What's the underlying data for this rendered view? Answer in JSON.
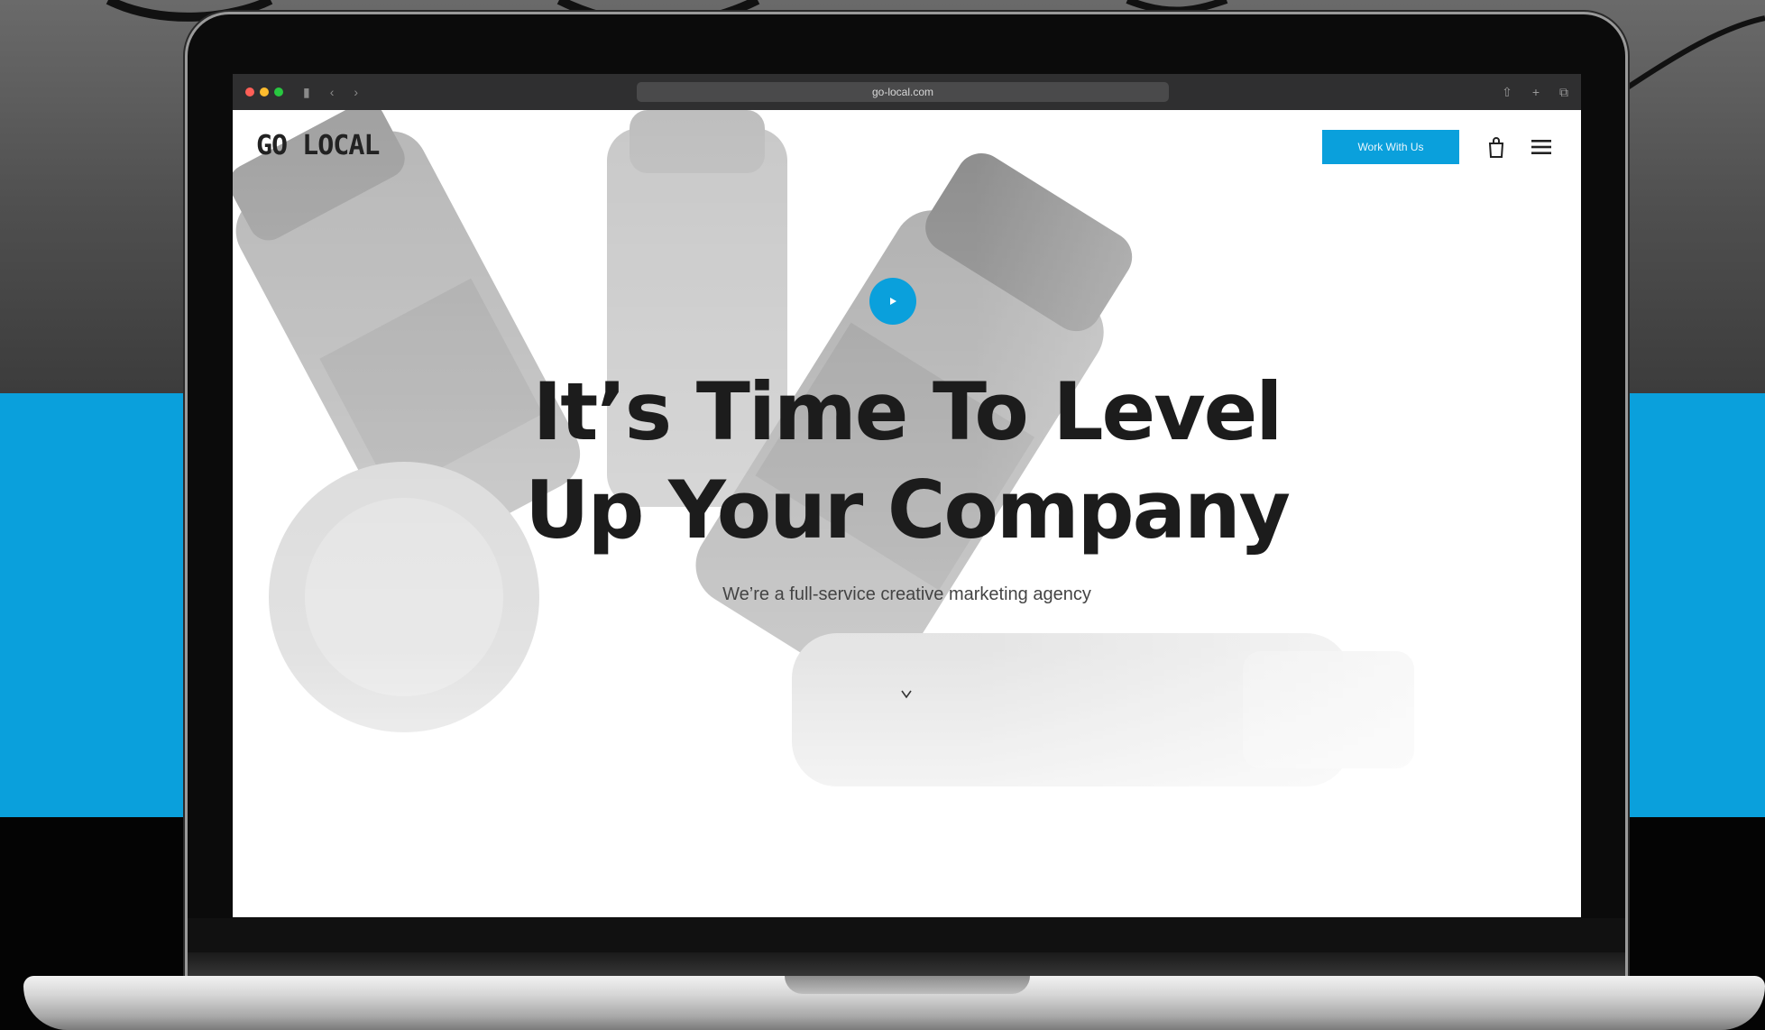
{
  "browser": {
    "url": "go-local.com",
    "traffic_lights": [
      "#ff5f57",
      "#febc2e",
      "#28c840"
    ]
  },
  "nav": {
    "logo": "GO LOCAL",
    "cta_label": "Work With Us"
  },
  "hero": {
    "title_line1": "It’s Time To Level",
    "title_line2": "Up Your Company",
    "subtitle": "We’re a full-service creative marketing agency"
  },
  "colors": {
    "accent": "#0aa0dc",
    "heading": "#1c1c1c",
    "chrome": "#2f2f30"
  },
  "icons": [
    "bag-icon",
    "menu-icon",
    "chevron-down-icon",
    "play-icon"
  ]
}
